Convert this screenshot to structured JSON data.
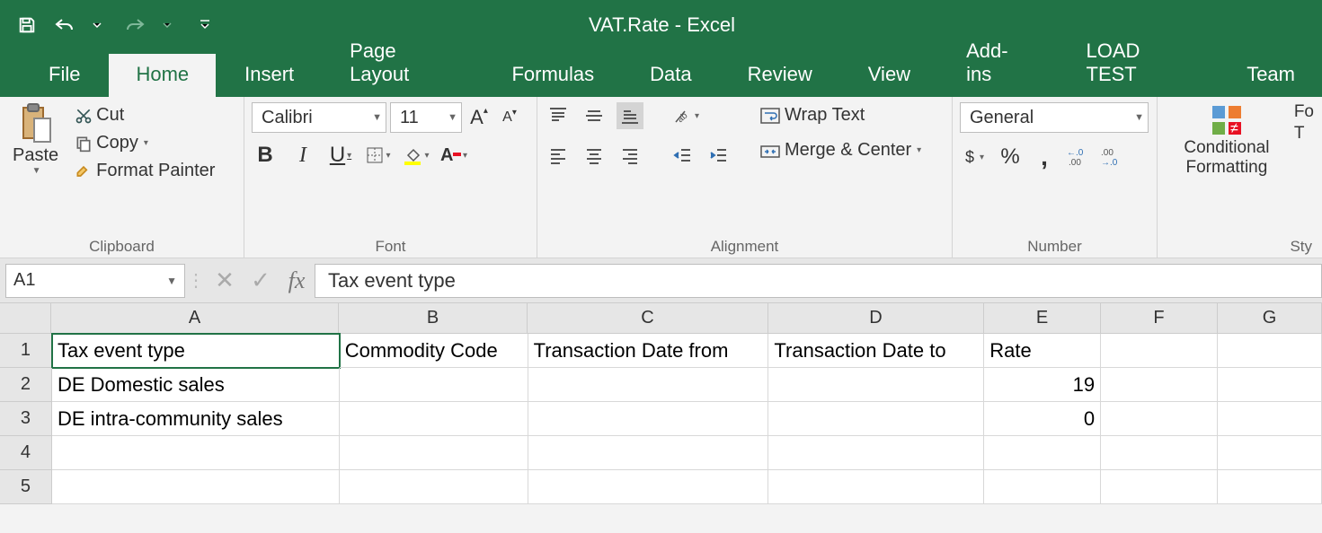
{
  "app": {
    "title": "VAT.Rate - Excel"
  },
  "tabs": {
    "file": "File",
    "home": "Home",
    "insert": "Insert",
    "pagelayout": "Page Layout",
    "formulas": "Formulas",
    "data": "Data",
    "review": "Review",
    "view": "View",
    "addins": "Add-ins",
    "loadtest": "LOAD TEST",
    "team": "Team"
  },
  "ribbon": {
    "clipboard": {
      "label": "Clipboard",
      "paste": "Paste",
      "cut": "Cut",
      "copy": "Copy",
      "fmtpainter": "Format Painter"
    },
    "font": {
      "label": "Font",
      "name": "Calibri",
      "size": "11",
      "bold": "B",
      "italic": "I",
      "underline": "U",
      "incA": "A",
      "decA": "A"
    },
    "alignment": {
      "label": "Alignment",
      "wrap": "Wrap Text",
      "merge": "Merge & Center"
    },
    "number": {
      "label": "Number",
      "format": "General",
      "currency": "$",
      "percent": "%",
      "comma": ",",
      "incdec_l": ".0",
      "incdec_r": ".00"
    },
    "styles": {
      "label": "Sty",
      "cond": "Conditional Formatting",
      "fmtas": "Fo",
      "fmtas2": "T"
    }
  },
  "formulabar": {
    "namebox": "A1",
    "fx": "fx",
    "value": "Tax event type"
  },
  "grid": {
    "cols": [
      "A",
      "B",
      "C",
      "D",
      "E",
      "F",
      "G"
    ],
    "colwidths": [
      "cw-A",
      "cw-B",
      "cw-C",
      "cw-D",
      "cw-E",
      "cw-F",
      "cw-G"
    ],
    "rows": [
      "1",
      "2",
      "3",
      "4",
      "5"
    ],
    "selected": "A1",
    "data": {
      "1": {
        "A": "Tax event type",
        "B": "Commodity Code",
        "C": "Transaction Date from",
        "D": "Transaction Date to",
        "E": "Rate"
      },
      "2": {
        "A": "DE Domestic sales",
        "E": "19"
      },
      "3": {
        "A": "DE intra-community sales",
        "E": "0"
      }
    },
    "numericCols": [
      "E"
    ]
  }
}
